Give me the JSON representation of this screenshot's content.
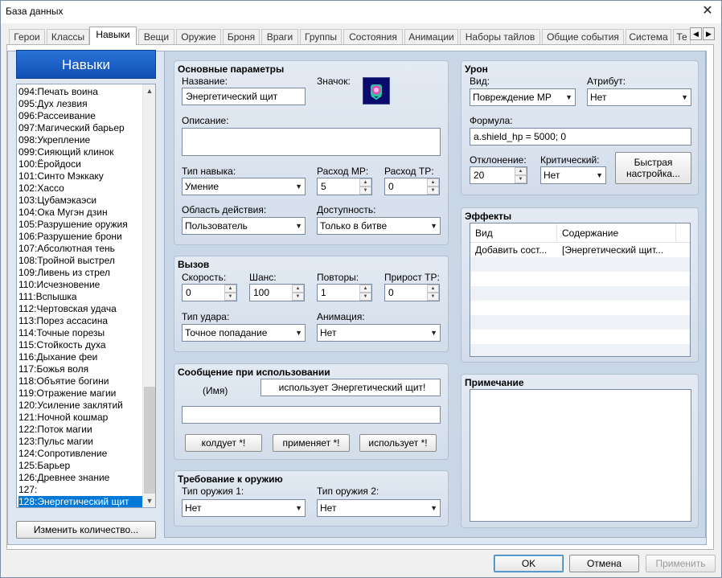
{
  "window": {
    "title": "База данных"
  },
  "tabs": [
    "Герои",
    "Классы",
    "Навыки",
    "Вещи",
    "Оружие",
    "Броня",
    "Враги",
    "Группы",
    "Состояния",
    "Анимации",
    "Наборы тайлов",
    "Общие события",
    "Система",
    "Те"
  ],
  "active_tab": "Навыки",
  "list": {
    "header": "Навыки",
    "items": [
      "094:Печать воина",
      "095:Дух лезвия",
      "096:Рассеивание",
      "097:Магический барьер",
      "098:Укрепление",
      "099:Сияющий клинок",
      "100:Ёройдоси",
      "101:Синто Мэккаку",
      "102:Хассо",
      "103:Цубамэкаэси",
      "104:Ока Мугэн дзин",
      "105:Разрушение оружия",
      "106:Разрушение брони",
      "107:Абсолютная тень",
      "108:Тройной выстрел",
      "109:Ливень из стрел",
      "110:Исчезновение",
      "111:Вспышка",
      "112:Чертовская удача",
      "113:Порез ассасина",
      "114:Точные порезы",
      "115:Стойкость духа",
      "116:Дыхание феи",
      "117:Божья воля",
      "118:Объятие богини",
      "119:Отражение магии",
      "120:Усиление заклятий",
      "121:Ночной кошмар",
      "122:Поток магии",
      "123:Пульс магии",
      "124:Сопротивление",
      "125:Барьер",
      "126:Древнее знание",
      "127:",
      "128:Энергетический щит"
    ],
    "selected_index": 34,
    "change_count_button": "Изменить количество..."
  },
  "basic": {
    "title": "Основные параметры",
    "name_label": "Название:",
    "name_value": "Энергетический щит",
    "icon_label": "Значок:",
    "desc_label": "Описание:",
    "desc_value": "",
    "skill_type_label": "Тип навыка:",
    "skill_type_value": "Умение",
    "mp_cost_label": "Расход MP:",
    "mp_cost_value": "5",
    "tp_cost_label": "Расход TP:",
    "tp_cost_value": "0",
    "scope_label": "Область действия:",
    "scope_value": "Пользователь",
    "occasion_label": "Доступность:",
    "occasion_value": "Только в битве"
  },
  "invocation": {
    "title": "Вызов",
    "speed_label": "Скорость:",
    "speed_value": "0",
    "success_label": "Шанс:",
    "success_value": "100",
    "repeat_label": "Повторы:",
    "repeat_value": "1",
    "tp_gain_label": "Прирост TP:",
    "tp_gain_value": "0",
    "hit_type_label": "Тип удара:",
    "hit_type_value": "Точное попадание",
    "animation_label": "Анимация:",
    "animation_value": "Нет"
  },
  "message": {
    "title": "Сообщение при использовании",
    "name_tag": "(Имя)",
    "line1": "использует Энергетический щит!",
    "line2": "",
    "btn_cast": "колдует *!",
    "btn_apply": "применяет *!",
    "btn_use": "использует *!"
  },
  "weapon_req": {
    "title": "Требование к оружию",
    "type1_label": "Тип оружия 1:",
    "type1_value": "Нет",
    "type2_label": "Тип оружия 2:",
    "type2_value": "Нет"
  },
  "damage": {
    "title": "Урон",
    "type_label": "Вид:",
    "type_value": "Повреждение MP",
    "element_label": "Атрибут:",
    "element_value": "Нет",
    "formula_label": "Формула:",
    "formula_value": "a.shield_hp = 5000; 0",
    "variance_label": "Отклонение:",
    "variance_value": "20",
    "critical_label": "Критический:",
    "critical_value": "Нет",
    "quick_setup_button": "Быстрая настройка..."
  },
  "effects": {
    "title": "Эффекты",
    "columns": [
      "Вид",
      "Содержание"
    ],
    "rows": [
      [
        "Добавить сост...",
        "[Энергетический щит..."
      ]
    ]
  },
  "note": {
    "title": "Примечание",
    "value": ""
  },
  "footer": {
    "ok": "OK",
    "cancel": "Отмена",
    "apply": "Применить"
  }
}
